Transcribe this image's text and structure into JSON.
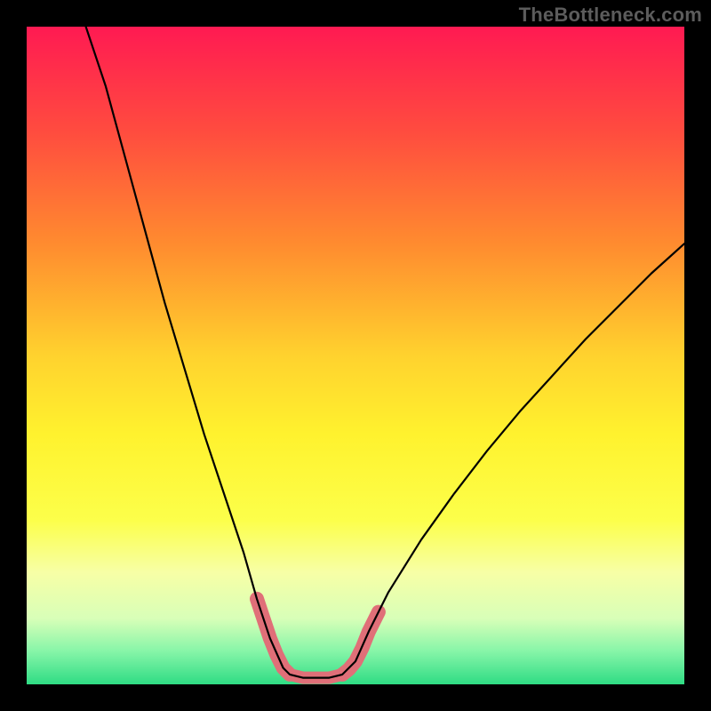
{
  "watermark": "TheBottleneck.com",
  "chart_data": {
    "type": "line",
    "title": "",
    "xlabel": "",
    "ylabel": "",
    "xlim": [
      0,
      100
    ],
    "ylim": [
      0,
      100
    ],
    "grid": false,
    "legend": false,
    "background_gradient_stops": [
      {
        "offset": 0.0,
        "color": "#ff1a52"
      },
      {
        "offset": 0.16,
        "color": "#ff4c3f"
      },
      {
        "offset": 0.33,
        "color": "#ff8b2f"
      },
      {
        "offset": 0.5,
        "color": "#ffd22e"
      },
      {
        "offset": 0.62,
        "color": "#fff22e"
      },
      {
        "offset": 0.75,
        "color": "#fcff4a"
      },
      {
        "offset": 0.83,
        "color": "#f7ffa6"
      },
      {
        "offset": 0.9,
        "color": "#d8ffb8"
      },
      {
        "offset": 0.95,
        "color": "#86f5a8"
      },
      {
        "offset": 1.0,
        "color": "#2fdc84"
      }
    ],
    "series": [
      {
        "name": "bottleneck-curve",
        "color": "#000000",
        "stroke_width": 2.2,
        "values": [
          {
            "x": 9.0,
            "y": 100.0
          },
          {
            "x": 12.0,
            "y": 91.0
          },
          {
            "x": 15.0,
            "y": 80.0
          },
          {
            "x": 18.0,
            "y": 69.0
          },
          {
            "x": 21.0,
            "y": 58.0
          },
          {
            "x": 24.0,
            "y": 48.0
          },
          {
            "x": 27.0,
            "y": 38.0
          },
          {
            "x": 30.0,
            "y": 29.0
          },
          {
            "x": 33.0,
            "y": 20.0
          },
          {
            "x": 35.0,
            "y": 13.0
          },
          {
            "x": 37.0,
            "y": 7.0
          },
          {
            "x": 39.0,
            "y": 2.5
          },
          {
            "x": 40.0,
            "y": 1.5
          },
          {
            "x": 42.0,
            "y": 1.0
          },
          {
            "x": 44.0,
            "y": 1.0
          },
          {
            "x": 46.0,
            "y": 1.0
          },
          {
            "x": 48.0,
            "y": 1.5
          },
          {
            "x": 50.0,
            "y": 3.5
          },
          {
            "x": 52.0,
            "y": 8.0
          },
          {
            "x": 55.0,
            "y": 14.0
          },
          {
            "x": 60.0,
            "y": 22.0
          },
          {
            "x": 65.0,
            "y": 29.0
          },
          {
            "x": 70.0,
            "y": 35.5
          },
          {
            "x": 75.0,
            "y": 41.5
          },
          {
            "x": 80.0,
            "y": 47.0
          },
          {
            "x": 85.0,
            "y": 52.5
          },
          {
            "x": 90.0,
            "y": 57.5
          },
          {
            "x": 95.0,
            "y": 62.5
          },
          {
            "x": 100.0,
            "y": 67.0
          }
        ]
      },
      {
        "name": "highlight-band-left",
        "color": "#e06f78",
        "stroke_width": 16,
        "values": [
          {
            "x": 35.0,
            "y": 13.0
          },
          {
            "x": 36.0,
            "y": 10.0
          },
          {
            "x": 37.0,
            "y": 7.0
          },
          {
            "x": 38.0,
            "y": 4.5
          },
          {
            "x": 39.0,
            "y": 2.5
          },
          {
            "x": 40.0,
            "y": 1.5
          }
        ]
      },
      {
        "name": "highlight-band-bottom",
        "color": "#e06f78",
        "stroke_width": 14,
        "values": [
          {
            "x": 40.0,
            "y": 1.5
          },
          {
            "x": 42.0,
            "y": 1.0
          },
          {
            "x": 44.0,
            "y": 1.0
          },
          {
            "x": 46.0,
            "y": 1.0
          },
          {
            "x": 48.0,
            "y": 1.5
          }
        ]
      },
      {
        "name": "highlight-band-right",
        "color": "#e06f78",
        "stroke_width": 16,
        "values": [
          {
            "x": 48.0,
            "y": 1.5
          },
          {
            "x": 49.0,
            "y": 2.3
          },
          {
            "x": 50.0,
            "y": 3.5
          },
          {
            "x": 51.0,
            "y": 5.5
          },
          {
            "x": 52.0,
            "y": 8.0
          },
          {
            "x": 53.5,
            "y": 11.0
          }
        ]
      }
    ]
  }
}
